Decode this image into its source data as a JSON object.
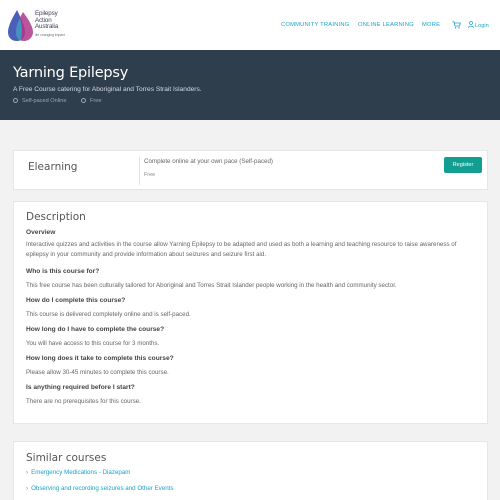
{
  "header": {
    "logo_lines": [
      "Epilepsy",
      "Action",
      "Australia"
    ],
    "logo_tagline": "life changing impact",
    "nav": [
      "COMMUNITY TRAINING",
      "ONLINE LEARNING",
      "MORE"
    ],
    "login": "Login"
  },
  "hero": {
    "title": "Yarning Epilepsy",
    "subtitle": "A Free Course catering for Aboriginal and Torres Strait Islanders.",
    "meta": [
      "Self-paced Online",
      "Free"
    ]
  },
  "elearning": {
    "title": "Elearning",
    "description": "Complete online at your own pace (Self-paced)",
    "price": "Free",
    "register": "Register"
  },
  "description": {
    "heading": "Description",
    "sections": [
      {
        "q": "Overview",
        "a": "Interactive quizzes and activities in the course allow Yarning Epilepsy to be adapted and used as both a learning and teaching resource to raise awareness of epilepsy in your community and provide information about seizures and seizure first aid."
      },
      {
        "q": "Who is this course for?",
        "a": "This free course has been culturally tailored for Aboriginal and Torres Strait Islander people working in the health and community sector."
      },
      {
        "q": "How do I complete this course?",
        "a": "This course is delivered completely online and is self-paced."
      },
      {
        "q": "How long do I have to complete the course?",
        "a": "You will have access to this course for 3 months."
      },
      {
        "q": "How long does it take to complete this course?",
        "a": "Please allow 30-45 minutes to complete this course."
      },
      {
        "q": "Is anything required before I start?",
        "a": "There are no prerequisites for this course."
      }
    ]
  },
  "similar": {
    "heading": "Similar courses",
    "links": [
      "Emergency Medications - Diazepam",
      "Observing and recording seizures and Other Events"
    ]
  },
  "colors": {
    "hero_bg": "#2f3e4d",
    "accent": "#1aa3c8",
    "button": "#129e91"
  }
}
